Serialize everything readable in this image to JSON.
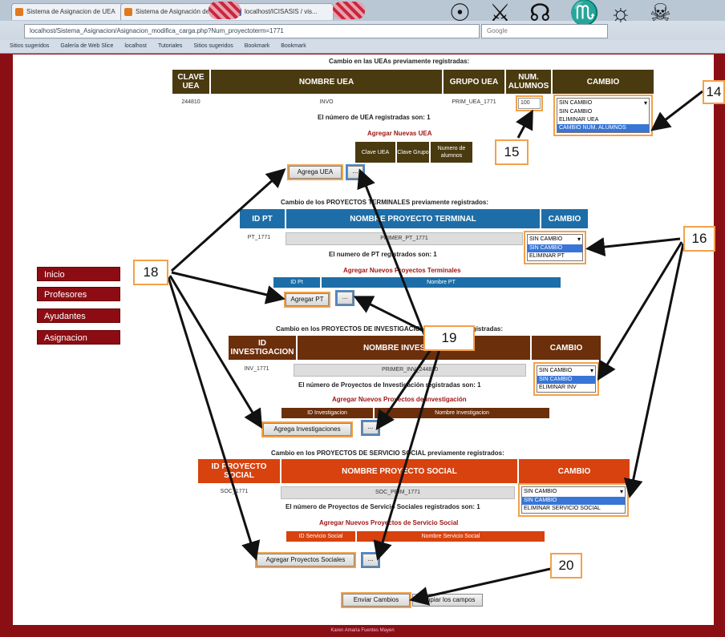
{
  "browser": {
    "tabs": [
      "Sistema de Asignacion de UEA",
      "Sistema de Asignación de U...",
      "localhost/ICISASIS / vis..."
    ],
    "url": "localhost/Sistema_Asignacion/Asignacion_modifica_carga.php?Num_proyectoterm=1771",
    "search_placeholder": "Google",
    "bookmarks": [
      "Sitios sugeridos",
      "Galería de Web Slice",
      "localhost",
      "Tutoriales",
      "Sitios sugeridos",
      "Bookmark",
      "Bookmark"
    ]
  },
  "nav": {
    "items": [
      "Inicio",
      "Profesores",
      "Ayudantes",
      "Asignacion"
    ]
  },
  "uea": {
    "section_title": "Cambio en las UEAs previamente registradas:",
    "headers": [
      "CLAVE UEA",
      "NOMBRE UEA",
      "GRUPO UEA",
      "NUM. ALUMNOS",
      "CAMBIO"
    ],
    "row": {
      "clave": "244810",
      "nombre": "INVO",
      "grupo": "PRIM_UEA_1771",
      "num_alumnos": "100"
    },
    "select_current": "SIN CAMBIO",
    "options": [
      "SIN CAMBIO",
      "ELIMINAR UEA",
      "CAMBIO NUM. ALUMNOS"
    ],
    "selected_option_index": 2,
    "count_text": "El número de UEA registradas son: 1",
    "add_title": "Agregar Nuevas UEA",
    "add_headers": [
      "Clave UEA",
      "Clave Grupo",
      "Numero de alumnos"
    ],
    "add_button": "Agrega UEA",
    "mini_button": "..."
  },
  "pt": {
    "section_title": "Cambio de los PROYECTOS TERMINALES previamente registrados:",
    "headers": [
      "ID PT",
      "NOMBRE PROYECTO TERMINAL",
      "CAMBIO"
    ],
    "row": {
      "id": "PT_1771",
      "nombre": "PRIMER_PT_1771"
    },
    "select_current": "SIN CAMBIO",
    "options": [
      "SIN CAMBIO",
      "ELIMINAR PT"
    ],
    "selected_option_index": 0,
    "count_text": "El numero de PT registrados son: 1",
    "add_title": "Agregar Nuevos Proyectos Terminales",
    "add_headers": [
      "ID Pt",
      "Nombre PT"
    ],
    "add_button": "Agregar PT",
    "mini_button": "..."
  },
  "inv": {
    "section_title": "Cambio en los PROYECTOS DE INVESTIGACION previamente registradas:",
    "headers": [
      "ID INVESTIGACION",
      "NOMBRE INVESTIGACION",
      "CAMBIO"
    ],
    "row": {
      "id": "INV_1771",
      "nombre": "PRIMER_INV_244810"
    },
    "select_current": "SIN CAMBIO",
    "options": [
      "SIN CAMBIO",
      "ELIMINAR INV"
    ],
    "selected_option_index": 0,
    "count_text": "El número de Proyectos de Investigación registradas son: 1",
    "add_title": "Agregar Nuevos Proyectos de Investigación",
    "add_headers": [
      "ID Investigacion",
      "Nombre Investigacion"
    ],
    "add_button": "Agrega Investigaciones",
    "mini_button": "..."
  },
  "ss": {
    "section_title": "Cambio en los PROYECTOS DE SERVICIO SOCIAL previamente registrados:",
    "headers": [
      "ID PROYECTO SOCIAL",
      "NOMBRE PROYECTO SOCIAL",
      "CAMBIO"
    ],
    "row": {
      "id": "SOC_1771",
      "nombre": "SOC_PRIM_1771"
    },
    "select_current": "SIN CAMBIO",
    "options": [
      "SIN CAMBIO",
      "ELIMINAR SERVICIO SOCIAL"
    ],
    "selected_option_index": 0,
    "count_text": "El número de Proyectos de Servicio Sociales registrados son: 1",
    "add_title": "Agregar Nuevos Proyectos de Servicio Social",
    "add_headers": [
      "ID Servicio Social",
      "Nombre Servicio Social"
    ],
    "add_button": "Agregar Proyectos Sociales",
    "mini_button": "..."
  },
  "actions": {
    "submit": "Enviar Cambios",
    "reset": "Limpiar los campos"
  },
  "footer": "Karen Amaria Fuentes Mayen",
  "callouts": [
    "14",
    "15",
    "16",
    "18",
    "19",
    "20"
  ],
  "colors": {
    "uea_header": "#4a3a10",
    "pt_header": "#1d6ea8",
    "inv_header": "#6b2f0c",
    "ss_header": "#d8420e",
    "nav": "#8d0c13",
    "callout_border": "#f2a14a"
  }
}
